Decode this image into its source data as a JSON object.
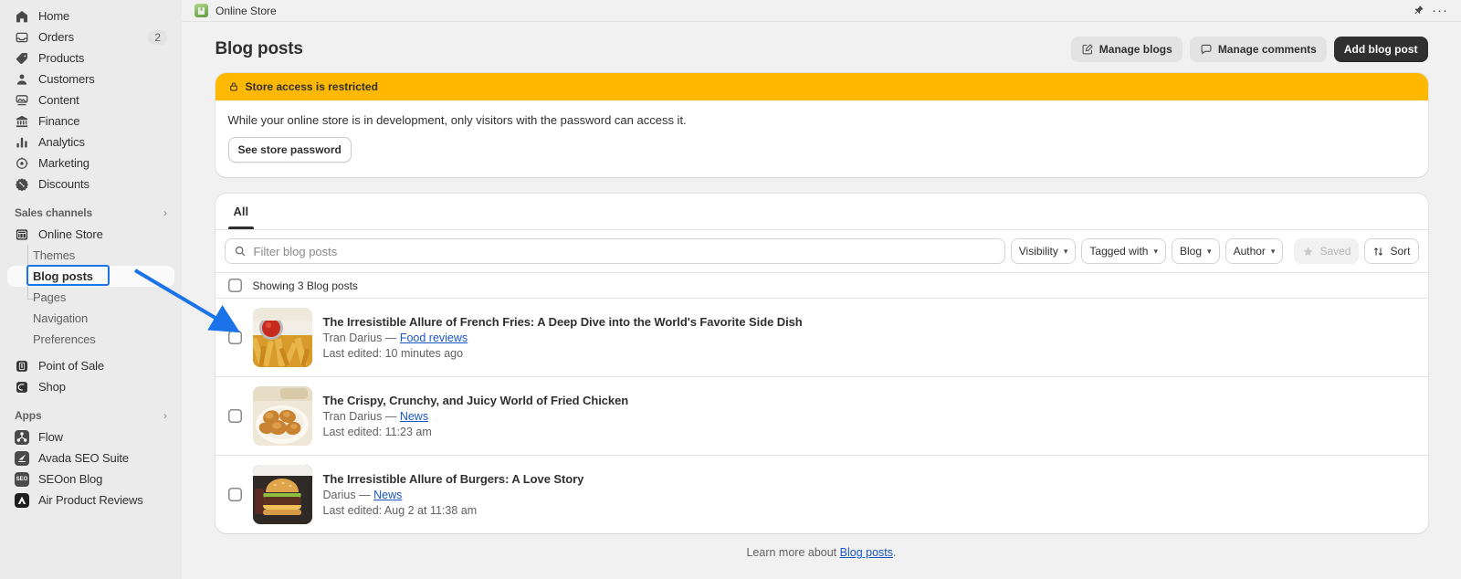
{
  "topbar": {
    "store_name": "Online Store",
    "pin_icon": "pin-icon",
    "more_icon": "ellipsis-icon"
  },
  "sidebar": {
    "main_items": [
      {
        "label": "Home",
        "icon": "home-icon",
        "badge": ""
      },
      {
        "label": "Orders",
        "icon": "orders-icon",
        "badge": "2"
      },
      {
        "label": "Products",
        "icon": "products-tag-icon",
        "badge": ""
      },
      {
        "label": "Customers",
        "icon": "customers-person-icon",
        "badge": ""
      },
      {
        "label": "Content",
        "icon": "content-image-icon",
        "badge": ""
      },
      {
        "label": "Finance",
        "icon": "finance-bank-icon",
        "badge": ""
      },
      {
        "label": "Analytics",
        "icon": "analytics-bars-icon",
        "badge": ""
      },
      {
        "label": "Marketing",
        "icon": "marketing-megaphone-icon",
        "badge": ""
      },
      {
        "label": "Discounts",
        "icon": "discounts-percent-icon",
        "badge": ""
      }
    ],
    "sales_channels": {
      "title": "Sales channels",
      "chevron": "›",
      "items": [
        {
          "label": "Online Store",
          "icon": "online-store-icon"
        },
        {
          "label": "Point of Sale",
          "icon": "point-of-sale-icon"
        },
        {
          "label": "Shop",
          "icon": "shop-icon"
        }
      ],
      "online_store_children": [
        {
          "label": "Themes",
          "active": false
        },
        {
          "label": "Blog posts",
          "active": true
        },
        {
          "label": "Pages",
          "active": false
        },
        {
          "label": "Navigation",
          "active": false
        },
        {
          "label": "Preferences",
          "active": false
        }
      ]
    },
    "apps": {
      "title": "Apps",
      "chevron": "›",
      "items": [
        {
          "label": "Flow",
          "icon": "flow-app-icon",
          "mark": "∴"
        },
        {
          "label": "Avada SEO Suite",
          "icon": "avada-seo-app-icon",
          "mark": "◤"
        },
        {
          "label": "SEOon Blog",
          "icon": "seoon-blog-app-icon",
          "mark": "SEO"
        },
        {
          "label": "Air Product Reviews",
          "icon": "air-product-reviews-app-icon",
          "mark": "▲"
        }
      ]
    }
  },
  "page": {
    "title": "Blog posts",
    "actions": {
      "manage_blogs": "Manage blogs",
      "manage_blogs_icon": "edit-square-icon",
      "manage_comments": "Manage comments",
      "manage_comments_icon": "comment-bubble-icon",
      "add_blog_post": "Add blog post"
    }
  },
  "banner": {
    "icon": "lock-icon",
    "heading": "Store access is restricted",
    "body": "While your online store is in development, only visitors with the password can access it.",
    "button": "See store password",
    "color": "#ffb800"
  },
  "list_card": {
    "tabs": [
      {
        "label": "All",
        "active": true
      }
    ],
    "search": {
      "placeholder": "Filter blog posts",
      "value": "",
      "icon": "search-icon"
    },
    "filters": [
      {
        "label": "Visibility",
        "chevron": "∨"
      },
      {
        "label": "Tagged with",
        "chevron": "∨"
      },
      {
        "label": "Blog",
        "chevron": "∨"
      },
      {
        "label": "Author",
        "chevron": "∨"
      }
    ],
    "saved": {
      "label": "Saved",
      "icon": "star-icon"
    },
    "sort": {
      "label": "Sort",
      "icon": "sort-arrows-icon"
    },
    "showing": "Showing 3 Blog posts",
    "rows": [
      {
        "title": "The Irresistible Allure of French Fries: A Deep Dive into the World's Favorite Side Dish",
        "author": "Tran Darius",
        "dash": "—",
        "blog": "Food reviews",
        "edited": "Last edited: 10 minutes ago",
        "thumb": "french-fries-thumbnail"
      },
      {
        "title": "The Crispy, Crunchy, and Juicy World of Fried Chicken",
        "author": "Tran Darius",
        "dash": "—",
        "blog": "News",
        "edited": "Last edited: 11:23 am",
        "thumb": "fried-chicken-thumbnail"
      },
      {
        "title": "The Irresistible Allure of Burgers: A Love Story",
        "author": "Darius",
        "dash": "—",
        "blog": "News",
        "edited": "Last edited: Aug 2 at 11:38 am",
        "thumb": "burger-thumbnail"
      }
    ]
  },
  "footer": {
    "prefix": "Learn more about ",
    "link": "Blog posts",
    "suffix": "."
  },
  "annotation": {
    "arrow_color": "#1a73e8",
    "highlight_color": "#1a73e8",
    "highlight_target": "Blog posts"
  }
}
